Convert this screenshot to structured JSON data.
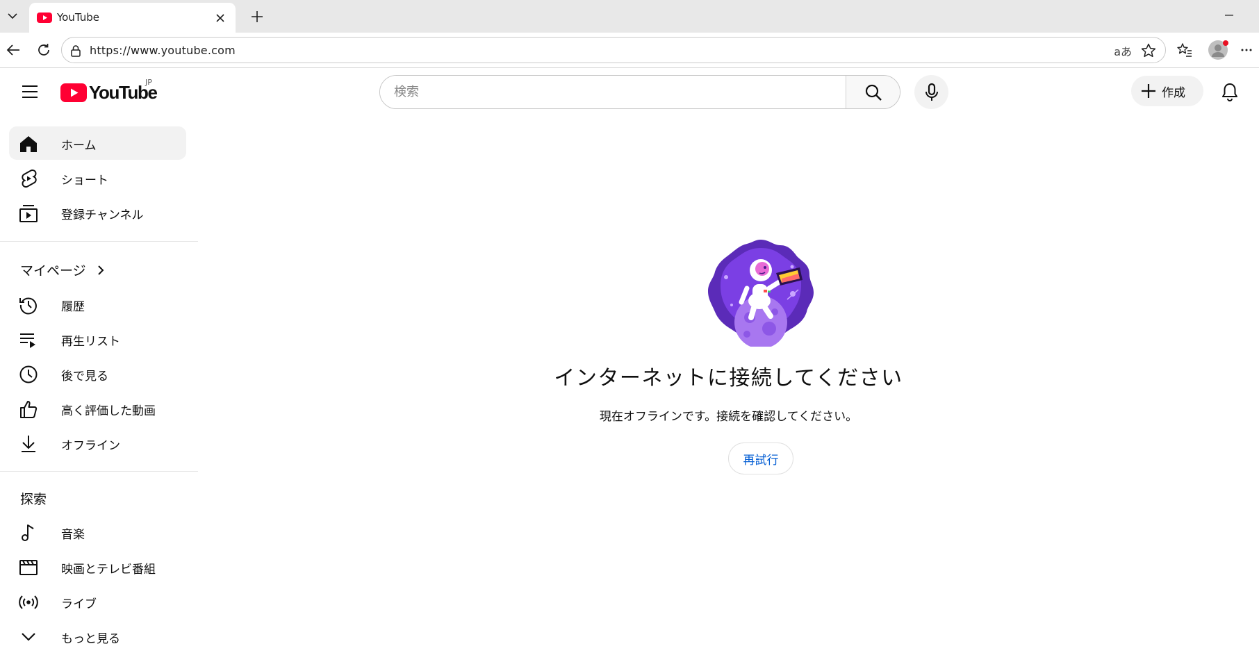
{
  "browser": {
    "tab_title": "YouTube",
    "url": "https://www.youtube.com",
    "read_aloud_glyph": "aあ"
  },
  "masthead": {
    "logo_text": "YouTube",
    "region": "JP",
    "search_placeholder": "検索",
    "create_label": "作成"
  },
  "sidebar": {
    "main_items": [
      {
        "label": "ホーム",
        "icon": "home-icon"
      },
      {
        "label": "ショート",
        "icon": "shorts-icon"
      },
      {
        "label": "登録チャンネル",
        "icon": "subscriptions-icon"
      }
    ],
    "you_section_title": "マイページ",
    "you_items": [
      {
        "label": "履歴",
        "icon": "history-icon"
      },
      {
        "label": "再生リスト",
        "icon": "playlist-icon"
      },
      {
        "label": "後で見る",
        "icon": "watch-later-icon"
      },
      {
        "label": "高く評価した動画",
        "icon": "like-icon"
      },
      {
        "label": "オフライン",
        "icon": "download-icon"
      }
    ],
    "explore_title": "探索",
    "explore_items": [
      {
        "label": "音楽",
        "icon": "music-icon"
      },
      {
        "label": "映画とテレビ番組",
        "icon": "movies-icon"
      },
      {
        "label": "ライブ",
        "icon": "live-icon"
      },
      {
        "label": "もっと見る",
        "icon": "chevron-down-icon"
      }
    ]
  },
  "offline": {
    "title": "インターネットに接続してください",
    "message": "現在オフラインです。接続を確認してください。",
    "retry_label": "再試行"
  },
  "colors": {
    "brand_red": "#ff0033",
    "link_blue": "#065fd4",
    "illustration_purple": "#6e2fd6"
  }
}
